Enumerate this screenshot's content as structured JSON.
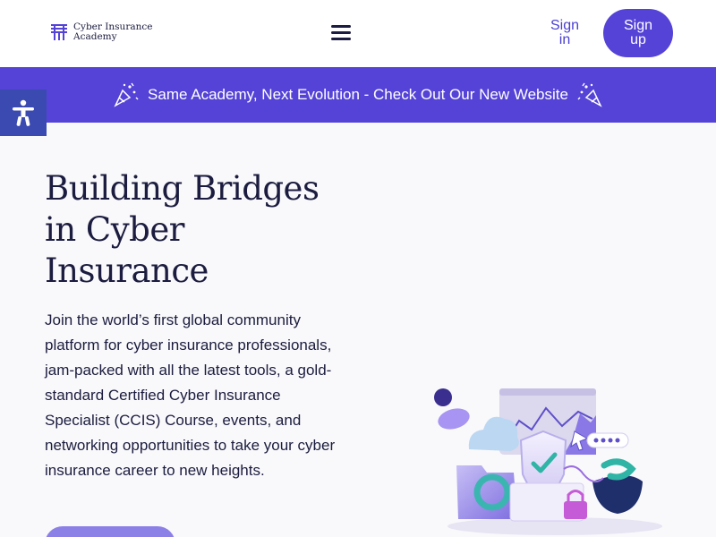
{
  "header": {
    "logo_line1": "Cyber Insurance",
    "logo_line2": "Academy",
    "menu_icon": "hamburger-menu-icon",
    "signin_line1": "Sign",
    "signin_line2": "in",
    "signup_line1": "Sign",
    "signup_line2": "up"
  },
  "banner": {
    "text": "Same Academy, Next Evolution - Check Out Our New Website",
    "icon": "party-popper-icon"
  },
  "accessibility": {
    "icon": "accessibility-icon"
  },
  "hero": {
    "title_line1": "Building Bridges",
    "title_line2": "in Cyber",
    "title_line3": "Insurance",
    "description": "Join the world’s first global community platform for cyber insurance professionals, jam-packed with all the latest tools, a gold-standard Certified Cyber Insurance Specialist (CCIS) Course, events, and networking opportunities to take your cyber insurance career to new heights."
  },
  "colors": {
    "brand": "#5443d6",
    "text": "#1b1c3f",
    "background": "#f9f9fb"
  }
}
